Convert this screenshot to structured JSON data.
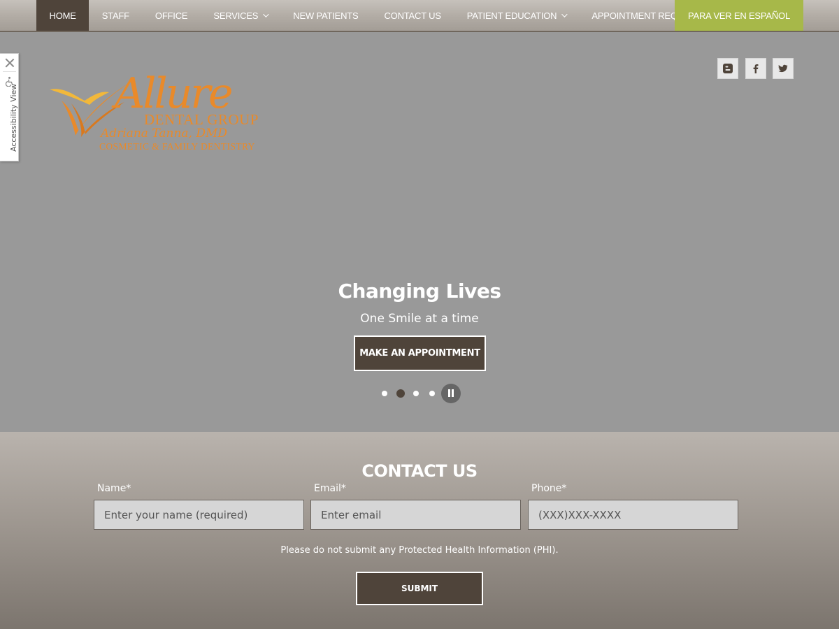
{
  "nav": {
    "items": [
      {
        "label": "HOME"
      },
      {
        "label": "STAFF"
      },
      {
        "label": "OFFICE"
      },
      {
        "label": "SERVICES"
      },
      {
        "label": "NEW PATIENTS"
      },
      {
        "label": "CONTACT US"
      },
      {
        "label": "PATIENT EDUCATION"
      },
      {
        "label": "APPOINTMENT REQUEST"
      }
    ],
    "espanol_label": "PARA VER EN ESPAÑOL"
  },
  "accessibility": {
    "label": "Accessibility View"
  },
  "logo": {
    "brand": "Allure",
    "line1": "DENTAL GROUP",
    "doctor": "Adriana Tanna, DMD",
    "tagline": "COSMETIC & FAMILY DENTISTRY"
  },
  "social": {
    "icons": [
      "blogger-icon",
      "facebook-icon",
      "twitter-icon"
    ]
  },
  "hero": {
    "title": "Changing Lives",
    "subtitle": "One Smile at a time",
    "button_label": "MAKE AN APPOINTMENT",
    "slide_count": 4,
    "active_slide": 2
  },
  "contact": {
    "title": "CONTACT US",
    "name_label": "Name*",
    "name_placeholder": "Enter your name (required)",
    "email_label": "Email*",
    "email_placeholder": "Enter email",
    "phone_label": "Phone*",
    "phone_placeholder": "(XXX)XXX-XXXX",
    "disclaimer": "Please do not submit any Protected Health Information (PHI).",
    "submit_label": "SUBMIT"
  },
  "colors": {
    "brand_dark": "#4f443a",
    "accent_green": "#a7b849",
    "logo_orange": "#e98a2a",
    "hero_bg": "#999999"
  }
}
